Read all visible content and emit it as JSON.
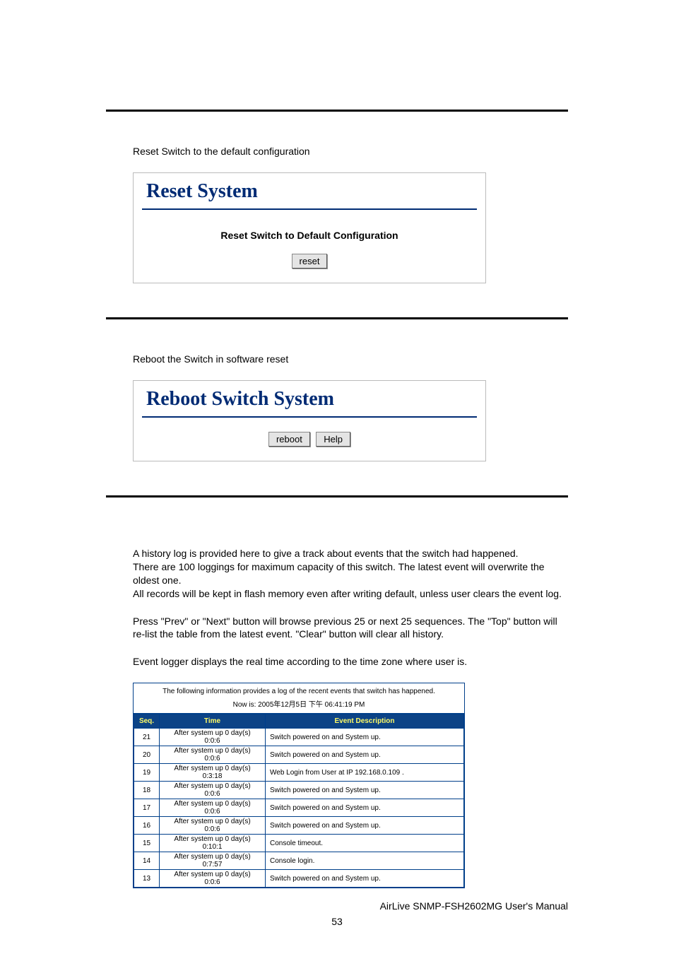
{
  "section1": {
    "intro": "Reset Switch to the default configuration",
    "panel_title": "Reset System",
    "panel_sub": "Reset Switch to Default Configuration",
    "reset_btn": "reset"
  },
  "section2": {
    "intro": "Reboot the Switch in software reset",
    "panel_title": "Reboot Switch System",
    "reboot_btn": "reboot",
    "help_btn": "Help"
  },
  "section3": {
    "para1a": "A history log is provided here to give a track about events that the switch had happened.",
    "para1b": "There are 100 loggings for maximum capacity of this switch. The latest event will overwrite the oldest one.",
    "para1c": "All records will be kept in flash memory even after writing default, unless user clears the event log.",
    "para2": "Press \"Prev\" or \"Next\" button will browse previous 25 or next 25 sequences. The \"Top\" button will re-list the table from the latest event. \"Clear\" button will clear all history.",
    "para3": "Event logger displays the real time according to the time zone where user is."
  },
  "log": {
    "caption": "The following information provides a log of the recent events that switch has happened.",
    "now": "Now is: 2005年12月5日 下午 06:41:19 PM",
    "headers": {
      "seq": "Seq.",
      "time": "Time",
      "desc": "Event Description"
    },
    "rows": [
      {
        "seq": "21",
        "time1": "After system up 0 day(s)",
        "time2": "0:0:6",
        "desc": "Switch powered on and System up."
      },
      {
        "seq": "20",
        "time1": "After system up 0 day(s)",
        "time2": "0:0:6",
        "desc": "Switch powered on and System up."
      },
      {
        "seq": "19",
        "time1": "After system up 0 day(s)",
        "time2": "0:3:18",
        "desc": "Web Login from User at IP 192.168.0.109 ."
      },
      {
        "seq": "18",
        "time1": "After system up 0 day(s)",
        "time2": "0:0:6",
        "desc": "Switch powered on and System up."
      },
      {
        "seq": "17",
        "time1": "After system up 0 day(s)",
        "time2": "0:0:6",
        "desc": "Switch powered on and System up."
      },
      {
        "seq": "16",
        "time1": "After system up 0 day(s)",
        "time2": "0:0:6",
        "desc": "Switch powered on and System up."
      },
      {
        "seq": "15",
        "time1": "After system up 0 day(s)",
        "time2": "0:10:1",
        "desc": "Console timeout."
      },
      {
        "seq": "14",
        "time1": "After system up 0 day(s)",
        "time2": "0:7:57",
        "desc": "Console login."
      },
      {
        "seq": "13",
        "time1": "After system up 0 day(s)",
        "time2": "0:0:6",
        "desc": "Switch powered on and System up."
      }
    ]
  },
  "footer": "AirLive SNMP-FSH2602MG User's Manual",
  "pagenum": "53"
}
